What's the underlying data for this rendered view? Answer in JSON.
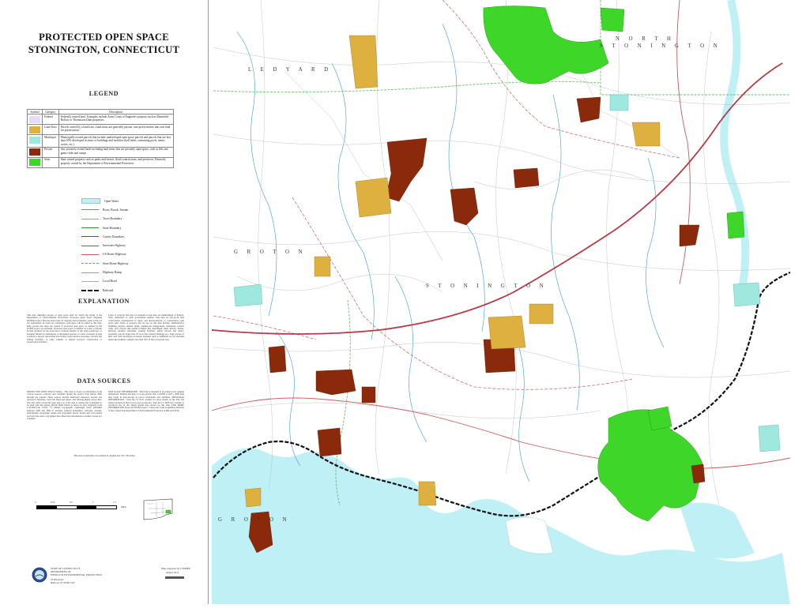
{
  "title": {
    "line1": "PROTECTED OPEN SPACE",
    "line2": "STONINGTON, CONNECTICUT"
  },
  "headings": {
    "legend": "LEGEND",
    "explanation": "EXPLANATION",
    "data_sources": "DATA SOURCES"
  },
  "legend_table": {
    "col_symbol": "Symbol",
    "col_category": "Category",
    "col_description": "Description",
    "rows": [
      {
        "category": "Federal",
        "description": "Federally owned land. Examples include Army Corps of Engineers property such as Mansfield Hollow or Thomaston Dam properties.",
        "color": "#e6dcf5"
      },
      {
        "category": "Land Trust",
        "description": "Parcels owned by a land trust. Land trusts are generally private, non-profit entities that own land for preservation.",
        "color": "#ddb040"
      },
      {
        "category": "Municipal",
        "description": "Municipally-owned parcels that include undeveloped open space parcels and parcels that are less than 50% developed in terms of buildings and facilities (ball fields, swimming pools, tennis courts, etc.).",
        "color": "#9fe8e0"
      },
      {
        "category": "Private",
        "description": "Any privately owned lands including land trusts that are privately open space, such as fish and game clubs and camps.",
        "color": "#8b2a0a"
      },
      {
        "category": "State",
        "description": "State owned property such as parks and forests, flood control areas, and preserves. Primarily property owned by the Department of Environmental Protection.",
        "color": "#3fd62a"
      }
    ]
  },
  "line_legend": [
    {
      "label": "Open Water",
      "color": "#bff0f6",
      "style": "fill"
    },
    {
      "label": "River, Brook, Stream",
      "color": "#3a9ad8",
      "style": "solid"
    },
    {
      "label": "Town Boundary",
      "color": "#6cc06c",
      "style": "solid"
    },
    {
      "label": "State Boundary",
      "color": "#2a8a2a",
      "style": "solid"
    },
    {
      "label": "County Boundary",
      "color": "#1d7a1d",
      "style": "solid"
    },
    {
      "label": "Interstate Highway",
      "color": "#c23a3a",
      "style": "solid"
    },
    {
      "label": "US Route Highway",
      "color": "#c85a5a",
      "style": "solid"
    },
    {
      "label": "State Route Highway",
      "color": "#d07070",
      "style": "dashed"
    },
    {
      "label": "Highway Ramp",
      "color": "#d88080",
      "style": "solid"
    },
    {
      "label": "Local Road",
      "color": "#aaaaaa",
      "style": "solid"
    },
    {
      "label": "Railroad",
      "color": "#111111",
      "style": "rail"
    }
  ],
  "explanation": {
    "col1": "This map identifies parcels of open space land for which the holder is the Department of Environmental Protection's Protected Open Space Mapping (POSM) project. Because this project is ongoing and incomplete, some towns are not represented. In towns not completed, open space will be added to this map. Only parcels that meet the criteria of protected open space as defined by the POSM project are included. Protected open space is defined as: Land or interest in land acquired for the protection of natural features of the state's landscape, or essential habitat for endangered or threatened species; or Land or interest in land acquired to support and sustain non-facility based outdoor recreation, forestry and fishing activities, or other wildlife or natural resource conservation or preservation activities.",
    "col2": "Types of property that may be included in this map are landholdings of Federal, State, municipal, or other government entities; land held by non-profit land conservation organizations or trusts; and deed-restricted, or conservation open space land. Types of property that are not on this map include: administrative buildings, airports, athletic fields, commercial campgrounds, cemeteries, country clubs, golf courses that permit facilities that department lands, historic homes, libraries, marinas, museums, parking facilities, public schools and others. Generally, parcels larger than 50 acres that contain buildings on a large portion of their area with developed recreation facilities such as ballfields are not included unless the facilities comprise less than 50% of the total parcel area."
  },
  "data_sources": {
    "col1": "PROTECTED OPEN SPACE DATA - This map is based on information from various sources collected and compiled during the period from March 2005 through the present. These sources include municipal Assessors records, the Assessor's Database, land title maps and deeds, and existing digital parcel data. The data reflect protected open space as of the date of update and is intended to be used with the legend. BASE MAP DATA is based on data originally from 1:24,000-scale USGS 7.5 minute topographic quadrangle maps published between 1969 and 1984. It includes political boundaries, railroads, streams, hydrography, geographic names and geographic places. Roads and town names are from Tele Atlas copyrighted data. Base map information is neither current nor complete.",
    "col2": "MAP SCALE INFORMATION - This map is intended to be printed at its original dimensions. Printing this map at a scale greater than 1:24,000 (1 inch = 2000 feet) may result in inaccuracies in parcel boundaries and attributes. METADATA INFORMATION - Visit the CT ECO website for more details on the data and related projects at http://www.cteco.uconn.edu. Visit the CT DEP GIS website to download any of the digital spatial data shown on this map. FOR MORE INFORMATION about the POSM project, contact the Land Acquisition Division of the Connecticut Department of Environmental Protection at 860-424-3016."
  },
  "footer": {
    "disclaimer": "This map is intended to be printed at original size 36 x 36 inches",
    "scale_numbers": [
      "0",
      "0.25",
      "0.5",
      "1",
      "1.5"
    ],
    "scale_unit": "Miles",
    "agency_line1": "STATE OF CONNECTICUT",
    "agency_line2": "DEPARTMENT OF",
    "agency_line3": "ENERGY & ENVIRONMENTAL PROTECTION",
    "agency_line4": "79 Elm Street",
    "agency_line5": "Hartford, CT 06106-5127",
    "credit_line1": "Map prepared by CTDEEP",
    "credit_line2": "August 2011"
  },
  "map_labels": {
    "north_stonington_1": "N O R T H",
    "north_stonington_2": "S T O N I N G T O N",
    "ledyard": "L E D Y A R D",
    "groton_mid": "G R O T O N",
    "stonington": "S T O N I N G T O N",
    "groton_south": "G R O T O N"
  },
  "colors": {
    "state": "#3fd62a",
    "private": "#8b2a0a",
    "land_trust": "#ddb040",
    "municipal": "#9fe8e0",
    "water": "#bff0f6",
    "interstate": "#5a3fb0",
    "railroad": "#111111"
  }
}
